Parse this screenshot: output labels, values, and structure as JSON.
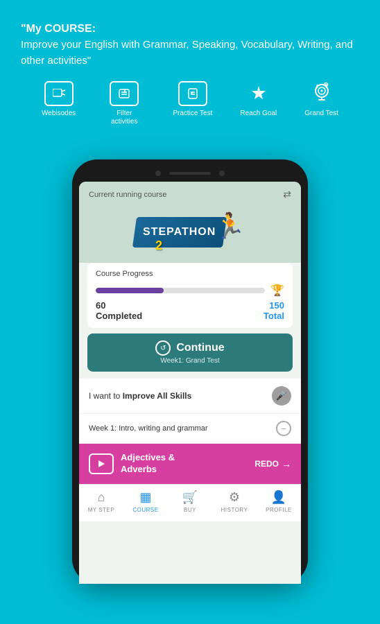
{
  "header": {
    "quote": "\"My COURSE:",
    "description": "Improve your English with Grammar, Speaking, Vocabulary, Writing, and other activities\""
  },
  "top_nav": [
    {
      "label": "Webisodes",
      "icon": "▶",
      "type": "box"
    },
    {
      "label": "Filter activities",
      "icon": "⊟",
      "type": "box"
    },
    {
      "label": "Practice Test",
      "icon": "✓",
      "type": "box"
    },
    {
      "label": "Reach Goal",
      "icon": "🏆",
      "type": "circle"
    },
    {
      "label": "Grand Test",
      "icon": "🎖",
      "type": "circle"
    }
  ],
  "phone": {
    "current_course_label": "Current running course",
    "stepathon_name": "STEPATHON",
    "stepathon_num": "2",
    "progress": {
      "title": "Course Progress",
      "completed": 60,
      "total": 150,
      "completed_label": "Completed",
      "total_label": "Total",
      "percent": 40
    },
    "continue_btn": {
      "label": "Continue",
      "sub_label": "Week1: Grand Test"
    },
    "improve_text": "I want to ",
    "improve_bold": "Improve All Skills",
    "week_label": "Week 1: Intro, writing and grammar",
    "lesson": {
      "title_line1": "Adjectives &",
      "title_line2": "Adverbs",
      "redo_label": "REDO"
    },
    "bottom_nav": [
      {
        "label": "MY STEP",
        "icon": "⌂",
        "active": false
      },
      {
        "label": "COURSE",
        "icon": "▦",
        "active": true
      },
      {
        "label": "BUY",
        "icon": "🛒",
        "active": false
      },
      {
        "label": "HISTORY",
        "icon": "⚙",
        "active": false
      },
      {
        "label": "PROFILE",
        "icon": "👤",
        "active": false
      }
    ]
  }
}
